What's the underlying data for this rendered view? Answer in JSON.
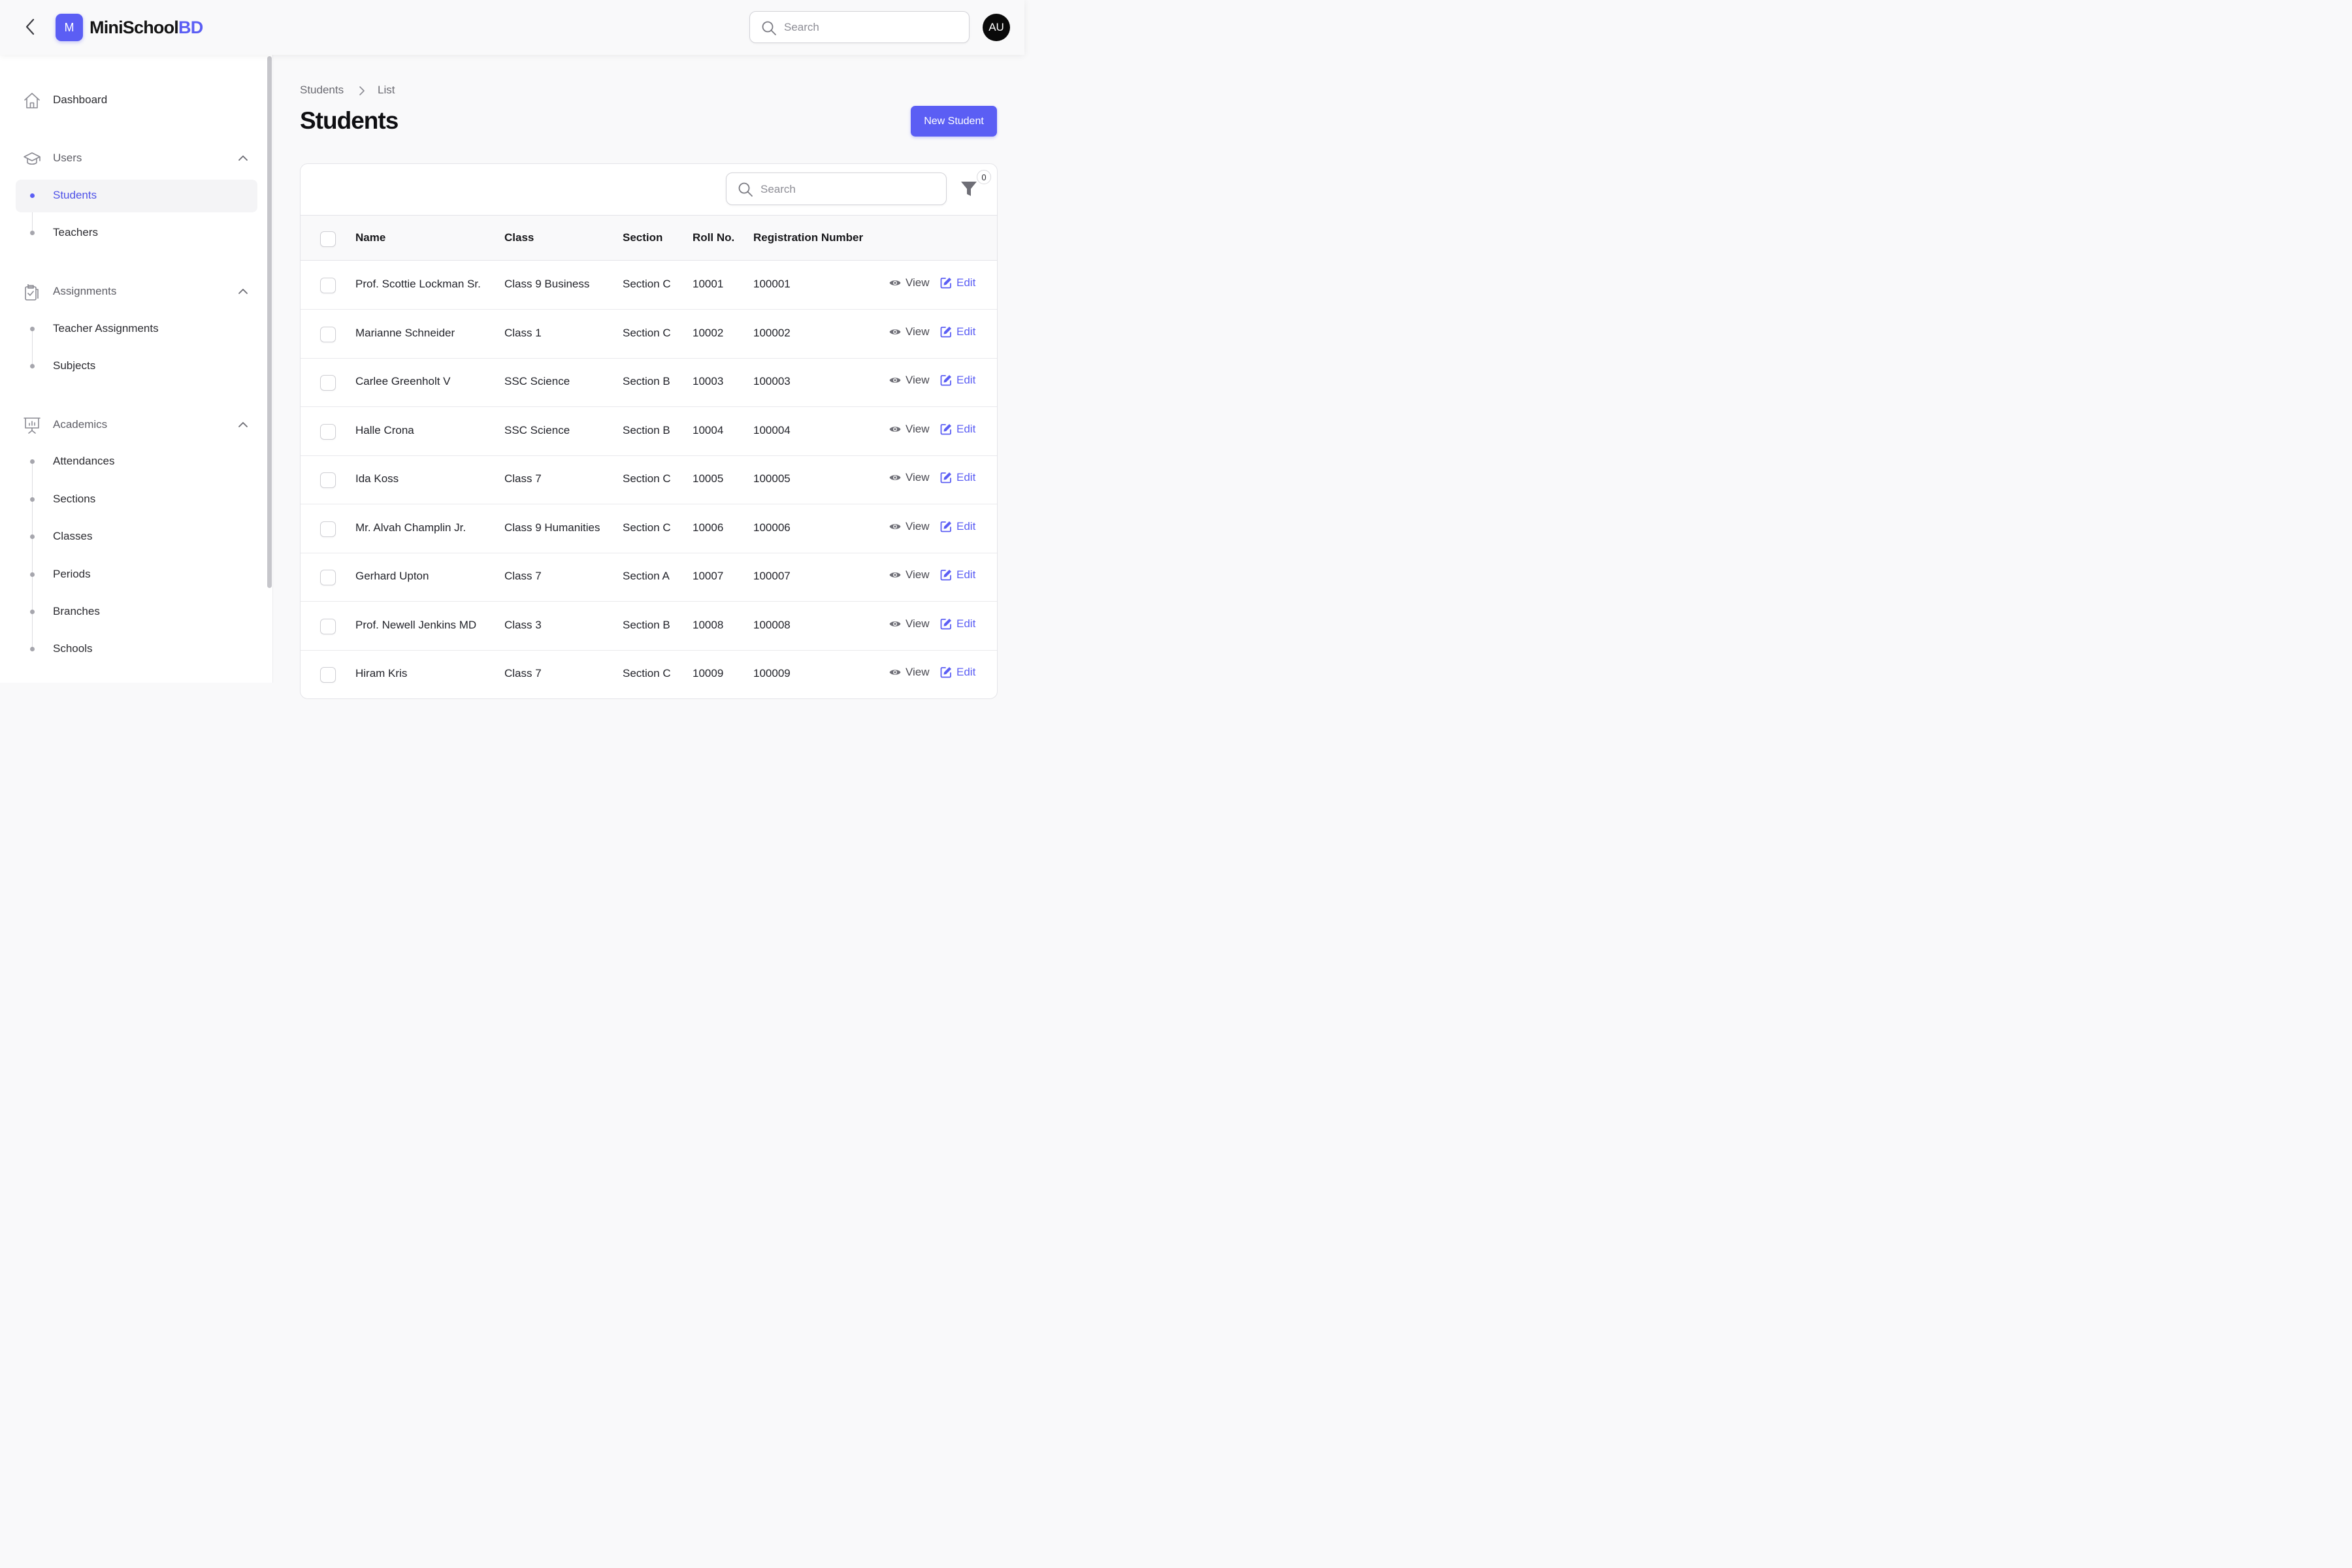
{
  "app": {
    "brand_main": "MiniSchool",
    "brand_accent": "BD",
    "logo_letter": "M",
    "search_placeholder": "Search",
    "avatar_initials": "AU",
    "accent_color": "#5b5ef4"
  },
  "sidebar": {
    "dashboard": "Dashboard",
    "groups": [
      {
        "label": "Users",
        "icon": "graduation-cap-icon",
        "items": [
          "Students",
          "Teachers"
        ]
      },
      {
        "label": "Assignments",
        "icon": "clipboard-check-icon",
        "items": [
          "Teacher Assignments",
          "Subjects"
        ]
      },
      {
        "label": "Academics",
        "icon": "presentation-chart-icon",
        "items": [
          "Attendances",
          "Sections",
          "Classes",
          "Periods",
          "Branches",
          "Schools"
        ]
      }
    ],
    "active_item": "Students"
  },
  "breadcrumb": {
    "first": "Students",
    "second": "List"
  },
  "page": {
    "title": "Students",
    "new_button": "New Student"
  },
  "table": {
    "search_placeholder": "Search",
    "filter_count": "0",
    "columns": [
      "Name",
      "Class",
      "Section",
      "Roll No.",
      "Registration Number"
    ],
    "view_label": "View",
    "edit_label": "Edit",
    "rows": [
      {
        "name": "Prof. Scottie Lockman Sr.",
        "class": "Class 9 Business",
        "section": "Section C",
        "roll": "10001",
        "reg": "100001"
      },
      {
        "name": "Marianne Schneider",
        "class": "Class 1",
        "section": "Section C",
        "roll": "10002",
        "reg": "100002"
      },
      {
        "name": "Carlee Greenholt V",
        "class": "SSC Science",
        "section": "Section B",
        "roll": "10003",
        "reg": "100003"
      },
      {
        "name": "Halle Crona",
        "class": "SSC Science",
        "section": "Section B",
        "roll": "10004",
        "reg": "100004"
      },
      {
        "name": "Ida Koss",
        "class": "Class 7",
        "section": "Section C",
        "roll": "10005",
        "reg": "100005"
      },
      {
        "name": "Mr. Alvah Champlin Jr.",
        "class": "Class 9 Humanities",
        "section": "Section C",
        "roll": "10006",
        "reg": "100006"
      },
      {
        "name": "Gerhard Upton",
        "class": "Class 7",
        "section": "Section A",
        "roll": "10007",
        "reg": "100007"
      },
      {
        "name": "Prof. Newell Jenkins MD",
        "class": "Class 3",
        "section": "Section B",
        "roll": "10008",
        "reg": "100008"
      },
      {
        "name": "Hiram Kris",
        "class": "Class 7",
        "section": "Section C",
        "roll": "10009",
        "reg": "100009"
      }
    ]
  }
}
